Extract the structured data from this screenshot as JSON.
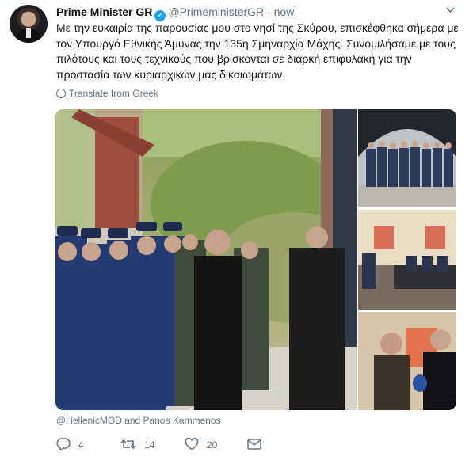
{
  "tweet": {
    "author_name": "Prime Minister GR",
    "handle": "@PrimeministerGR",
    "separator": "·",
    "time": "now",
    "text": "Με την ευκαιρία της παρουσίας μου στο νησί της Σκύρου, επισκέφθηκα σήμερα με τον Υπουργό Εθνικής Άμυνας την 135η Σμηναρχία Μάχης. Συνομιλήσαμε με τους πιλότους και τους τεχνικούς που βρίσκονται σε διαρκή επιφυλακή για την προστασία των κυριαρχικών μας δικαιωμάτων.",
    "translate_label": "Translate from Greek",
    "mentions": "@HellenicMOD and Panos Kammenos"
  },
  "actions": {
    "reply_count": "4",
    "retweet_count": "14",
    "like_count": "20"
  },
  "icons": {
    "verified": "verified-badge-icon",
    "menu": "chevron-down-icon",
    "translate": "globe-icon",
    "reply": "reply-icon",
    "retweet": "retweet-icon",
    "like": "heart-icon",
    "message": "envelope-icon"
  },
  "colors": {
    "accent": "#1da1f2",
    "muted": "#657786",
    "text": "#14171a"
  }
}
